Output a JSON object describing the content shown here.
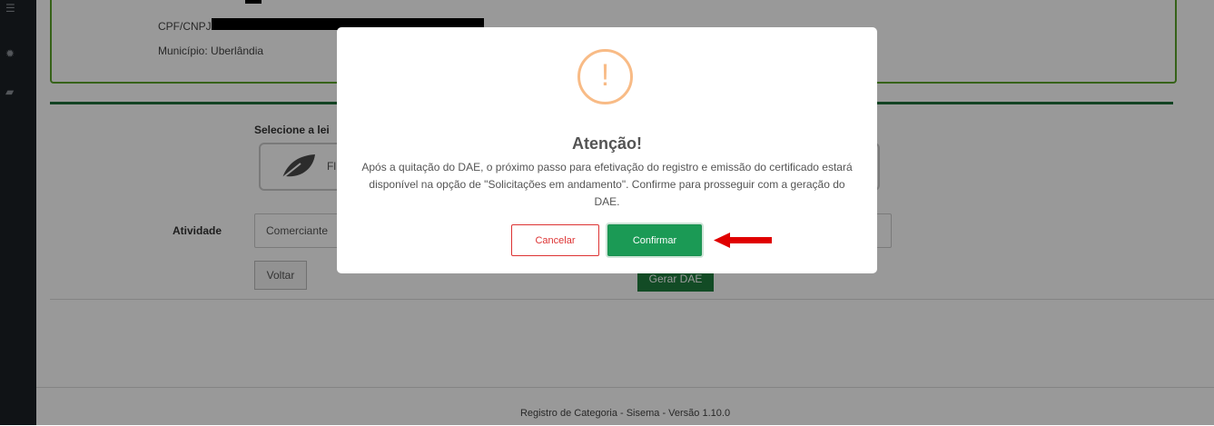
{
  "identity": {
    "cpf_label": "CPF/CNPJ:",
    "municipio": "Município: Uberlândia"
  },
  "form": {
    "lei_label": "Selecione a lei",
    "lei_option_text": "Fl",
    "atividade_label": "Atividade",
    "atividade_value": "Comerciante",
    "voltar_label": "Voltar",
    "gerar_label": "Gerar DAE"
  },
  "modal": {
    "icon": "!",
    "title": "Atenção!",
    "message": "Após a quitação do DAE, o próximo passo para efetivação do registro e emissão do certificado estará disponível na opção de \"Solicitações em andamento\". Confirme para prosseguir com a geração do DAE.",
    "cancel_label": "Cancelar",
    "confirm_label": "Confirmar"
  },
  "footer": {
    "text": "Registro de Categoria - Sisema - Versão 1.10.0"
  },
  "colors": {
    "accent_green": "#1b9a55",
    "cancel_red": "#dd3333",
    "warning": "#f8bb86",
    "arrow": "#e00000"
  },
  "icons": [
    "menu-icon",
    "gear-icon",
    "book-icon",
    "leaf-icon",
    "warning-icon",
    "arrow-left-icon"
  ]
}
